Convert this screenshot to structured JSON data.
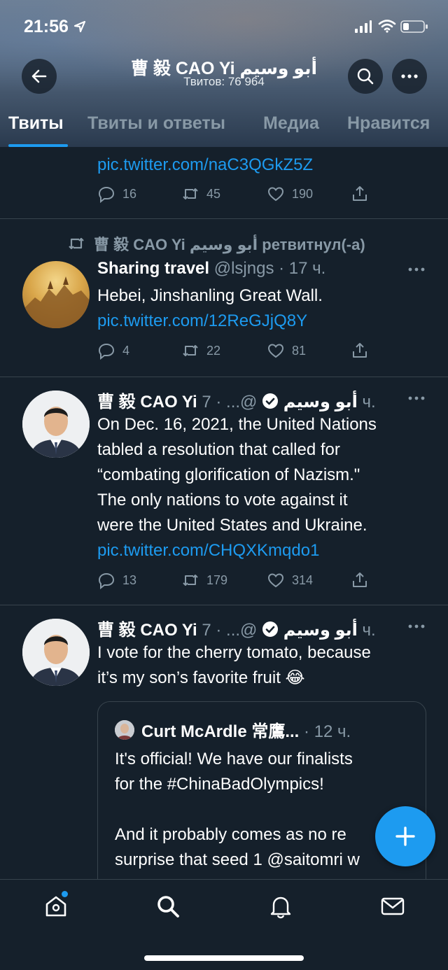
{
  "status_bar": {
    "time": "21:56"
  },
  "profile": {
    "name": "曹 毅 CAO Yi أبو وسيم",
    "tweet_count": "Твитов: 76 964"
  },
  "tabs": [
    {
      "label": "Твиты",
      "active": true
    },
    {
      "label": "Твиты и ответы",
      "active": false
    },
    {
      "label": "Медиа",
      "active": false
    },
    {
      "label": "Нравится",
      "active": false
    }
  ],
  "tweets": [
    {
      "link": "pic.twitter.com/naC3QGkZ5Z",
      "replies": "16",
      "retweets": "45",
      "likes": "190"
    },
    {
      "retweeted_by": "曹 毅 CAO Yi أبو وسيم ретвитнул(-а)",
      "author": "Sharing travel",
      "meta": "@lsjngs · 17 ч.",
      "text": "Hebei, Jinshanling Great Wall.",
      "link": "pic.twitter.com/12ReGJjQ8Y",
      "replies": "4",
      "retweets": "22",
      "likes": "81"
    },
    {
      "author": "曹 毅 CAO Yi أبو وسيم",
      "meta": "@... · 7 ч.",
      "text_lines": [
        "On Dec. 16, 2021, the United Nations",
        "tabled a resolution that called for",
        "“combating glorification of Nazism.\"",
        "The only nations to vote against it",
        "were the United States and Ukraine."
      ],
      "link": "pic.twitter.com/CHQXKmqdo1",
      "replies": "13",
      "retweets": "179",
      "likes": "314"
    },
    {
      "author": "曹 毅 CAO Yi أبو وسيم",
      "meta": "@... · 7 ч.",
      "text_lines": [
        "I vote for the cherry tomato, because",
        "it’s my son’s favorite fruit 😂"
      ],
      "quote": {
        "author": "Curt McArdle 常鷹...",
        "meta": "· 12 ч.",
        "text_lines": [
          "It's official! We have our finalists",
          "for the #ChinaBadOlympics!",
          "",
          "And it probably comes as no re",
          "surprise that seed 1 @saitomri w"
        ]
      }
    }
  ],
  "colors": {
    "accent": "#1d9bf0",
    "background": "#15202b",
    "muted": "#8899a6"
  }
}
